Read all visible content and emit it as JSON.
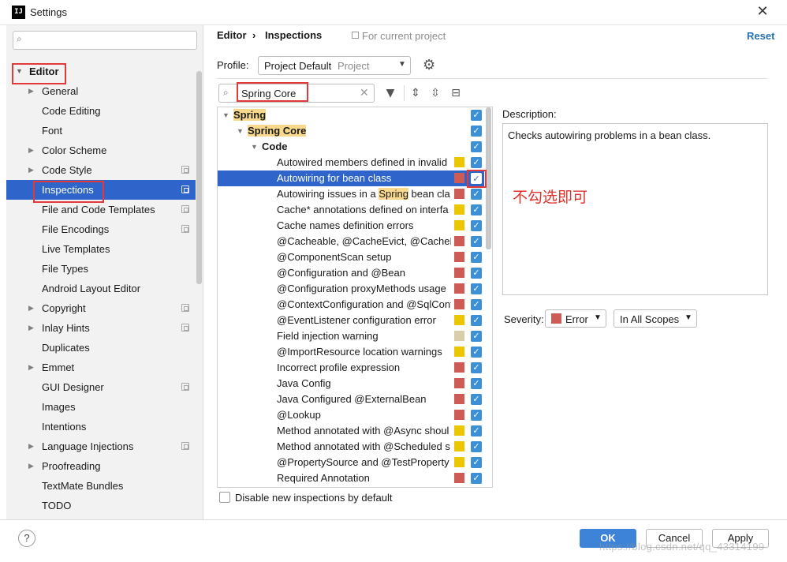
{
  "window": {
    "title": "Settings",
    "logo_text": "IJ"
  },
  "sidebar": {
    "editor_label": "Editor",
    "items": [
      {
        "label": "General",
        "expandable": true,
        "project": false
      },
      {
        "label": "Code Editing",
        "expandable": false,
        "project": false
      },
      {
        "label": "Font",
        "expandable": false,
        "project": false
      },
      {
        "label": "Color Scheme",
        "expandable": true,
        "project": false
      },
      {
        "label": "Code Style",
        "expandable": true,
        "project": true
      },
      {
        "label": "Inspections",
        "expandable": false,
        "project": true,
        "selected": true
      },
      {
        "label": "File and Code Templates",
        "expandable": false,
        "project": true
      },
      {
        "label": "File Encodings",
        "expandable": false,
        "project": true
      },
      {
        "label": "Live Templates",
        "expandable": false,
        "project": false
      },
      {
        "label": "File Types",
        "expandable": false,
        "project": false
      },
      {
        "label": "Android Layout Editor",
        "expandable": false,
        "project": false
      },
      {
        "label": "Copyright",
        "expandable": true,
        "project": true
      },
      {
        "label": "Inlay Hints",
        "expandable": true,
        "project": true
      },
      {
        "label": "Duplicates",
        "expandable": false,
        "project": false
      },
      {
        "label": "Emmet",
        "expandable": true,
        "project": false
      },
      {
        "label": "GUI Designer",
        "expandable": false,
        "project": true
      },
      {
        "label": "Images",
        "expandable": false,
        "project": false
      },
      {
        "label": "Intentions",
        "expandable": false,
        "project": false
      },
      {
        "label": "Language Injections",
        "expandable": true,
        "project": true
      },
      {
        "label": "Proofreading",
        "expandable": true,
        "project": false
      },
      {
        "label": "TextMate Bundles",
        "expandable": false,
        "project": false
      },
      {
        "label": "TODO",
        "expandable": false,
        "project": false
      }
    ]
  },
  "header": {
    "breadcrumb_editor": "Editor",
    "breadcrumb_sep": "›",
    "breadcrumb_page": "Inspections",
    "scope_note": "For current project",
    "reset_label": "Reset"
  },
  "profile": {
    "label": "Profile:",
    "value": "Project Default",
    "sub": "Project"
  },
  "filter": {
    "value": "Spring Core"
  },
  "tree": [
    {
      "level": 0,
      "arrow": true,
      "parts": [
        {
          "t": "Spring",
          "hl": true
        }
      ],
      "bold": true
    },
    {
      "level": 1,
      "arrow": true,
      "parts": [
        {
          "t": "Spring Core",
          "hl": true
        }
      ],
      "bold": true
    },
    {
      "level": 2,
      "arrow": true,
      "parts": [
        {
          "t": "Code",
          "hl": false
        }
      ],
      "bold": true
    },
    {
      "level": 3,
      "parts": [
        {
          "t": "Autowired members defined in invalid",
          "hl": false
        }
      ],
      "sev": "warning"
    },
    {
      "level": 3,
      "parts": [
        {
          "t": "Autowiring for bean class",
          "hl": false
        }
      ],
      "sev": "error",
      "selected": true
    },
    {
      "level": 3,
      "parts": [
        {
          "t": "Autowiring issues in a ",
          "hl": false
        },
        {
          "t": "Spring",
          "hl": true
        },
        {
          "t": " bean cla",
          "hl": false
        }
      ],
      "sev": "error"
    },
    {
      "level": 3,
      "parts": [
        {
          "t": "Cache* annotations defined on interfa",
          "hl": false
        }
      ],
      "sev": "warning"
    },
    {
      "level": 3,
      "parts": [
        {
          "t": "Cache names definition errors",
          "hl": false
        }
      ],
      "sev": "warning"
    },
    {
      "level": 3,
      "parts": [
        {
          "t": "@Cacheable, @CacheEvict, @CachePu",
          "hl": false
        }
      ],
      "sev": "error"
    },
    {
      "level": 3,
      "parts": [
        {
          "t": "@ComponentScan setup",
          "hl": false
        }
      ],
      "sev": "error"
    },
    {
      "level": 3,
      "parts": [
        {
          "t": "@Configuration and @Bean",
          "hl": false
        }
      ],
      "sev": "error"
    },
    {
      "level": 3,
      "parts": [
        {
          "t": "@Configuration proxyMethods usage",
          "hl": false
        }
      ],
      "sev": "error"
    },
    {
      "level": 3,
      "parts": [
        {
          "t": "@ContextConfiguration and @SqlConf",
          "hl": false
        }
      ],
      "sev": "error"
    },
    {
      "level": 3,
      "parts": [
        {
          "t": "@EventListener configuration error",
          "hl": false
        }
      ],
      "sev": "warning"
    },
    {
      "level": 3,
      "parts": [
        {
          "t": "Field injection warning",
          "hl": false
        }
      ],
      "sev": "weak"
    },
    {
      "level": 3,
      "parts": [
        {
          "t": "@ImportResource location warnings",
          "hl": false
        }
      ],
      "sev": "warning"
    },
    {
      "level": 3,
      "parts": [
        {
          "t": "Incorrect profile expression",
          "hl": false
        }
      ],
      "sev": "error"
    },
    {
      "level": 3,
      "parts": [
        {
          "t": "Java Config",
          "hl": false
        }
      ],
      "sev": "error"
    },
    {
      "level": 3,
      "parts": [
        {
          "t": "Java Configured @ExternalBean",
          "hl": false
        }
      ],
      "sev": "error"
    },
    {
      "level": 3,
      "parts": [
        {
          "t": "@Lookup",
          "hl": false
        }
      ],
      "sev": "error"
    },
    {
      "level": 3,
      "parts": [
        {
          "t": "Method annotated with @Async shoul",
          "hl": false
        }
      ],
      "sev": "warning"
    },
    {
      "level": 3,
      "parts": [
        {
          "t": "Method annotated with @Scheduled s",
          "hl": false
        }
      ],
      "sev": "warning"
    },
    {
      "level": 3,
      "parts": [
        {
          "t": "@PropertySource and @TestProperty",
          "hl": false
        }
      ],
      "sev": "warning"
    },
    {
      "level": 3,
      "parts": [
        {
          "t": "Required Annotation",
          "hl": false
        }
      ],
      "sev": "error"
    }
  ],
  "severity_colors": {
    "error": "#cf5b56",
    "warning": "#ebc700",
    "weak": "#d9ceac"
  },
  "description": {
    "label": "Description:",
    "text": "Checks autowiring problems in a bean class.",
    "annotation": "不勾选即可"
  },
  "severity": {
    "label": "Severity:",
    "value": "Error",
    "scope": "In All Scopes"
  },
  "options": {
    "disable_new_label": "Disable new inspections by default",
    "disable_new_checked": false
  },
  "footer": {
    "help": "?",
    "ok": "OK",
    "cancel": "Cancel",
    "apply": "Apply",
    "watermark": "https://blog.csdn.net/qq_43314199"
  },
  "colors": {
    "accent": "#2f65ca",
    "highlight": "#f7d88c",
    "annotation": "#e2302a",
    "checkbox": "#3d8fd8"
  }
}
